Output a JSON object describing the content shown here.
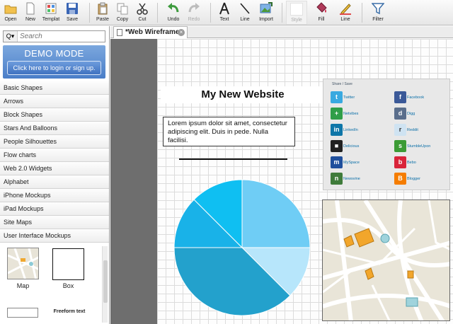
{
  "toolbar": {
    "open": "Open",
    "new": "New",
    "template": "Templat",
    "save": "Save",
    "paste": "Paste",
    "copy": "Copy",
    "cut": "Cut",
    "undo": "Undo",
    "redo": "Redo",
    "text": "Text",
    "line": "Line",
    "import": "Import",
    "style": "Style",
    "fill": "Fill",
    "line2": "Line",
    "filter": "Filter"
  },
  "sidebar": {
    "search_placeholder": "Search",
    "demo_title": "DEMO MODE",
    "demo_button": "Click here to login or sign up.",
    "categories": [
      "Basic Shapes",
      "Arrows",
      "Block Shapes",
      "Stars And Balloons",
      "People Silhouettes",
      "Flow charts",
      "Web 2.0 Widgets",
      "Alphabet",
      "iPhone Mockups",
      "iPad Mockups",
      "Site Maps",
      "User Interface Mockups"
    ],
    "shapes": {
      "map_label": "Map",
      "box_label": "Box",
      "freeform_label": "Freeform text"
    }
  },
  "tab": {
    "title": "*Web Wireframe"
  },
  "canvas": {
    "site_title": "My New Website",
    "lorem": "Lorem ipsum dolor sit amet, consectetur adipiscing elit. Duis in pede. Nulla facilisi.",
    "share_header": "Share / Save",
    "share_items": [
      {
        "name": "Twitter",
        "color": "#39a9e0",
        "glyph": "t"
      },
      {
        "name": "Facebook",
        "color": "#3b5998",
        "glyph": "f"
      },
      {
        "name": "Netvibes",
        "color": "#2f9e48",
        "glyph": "+"
      },
      {
        "name": "Digg",
        "color": "#5a6e8c",
        "glyph": "d"
      },
      {
        "name": "LinkedIn",
        "color": "#0e76a8",
        "glyph": "in"
      },
      {
        "name": "Reddit",
        "color": "#cfe3f2",
        "glyph": "r"
      },
      {
        "name": "Delicious",
        "color": "#222222",
        "glyph": "■"
      },
      {
        "name": "StumbleUpon",
        "color": "#3b9b35",
        "glyph": "s"
      },
      {
        "name": "MySpace",
        "color": "#1f4f9c",
        "glyph": "m"
      },
      {
        "name": "Bebo",
        "color": "#d9243a",
        "glyph": "b"
      },
      {
        "name": "Newsvine",
        "color": "#3f7b3a",
        "glyph": "n"
      },
      {
        "name": "Blogger",
        "color": "#f57d00",
        "glyph": "B"
      }
    ],
    "pie": {
      "colors": [
        "#6fcdf5",
        "#b7e6fb",
        "#23a1cc",
        "#19b2e8",
        "#0fbff2"
      ],
      "shares": [
        0.25,
        0.125,
        0.375,
        0.125,
        0.125
      ]
    }
  }
}
